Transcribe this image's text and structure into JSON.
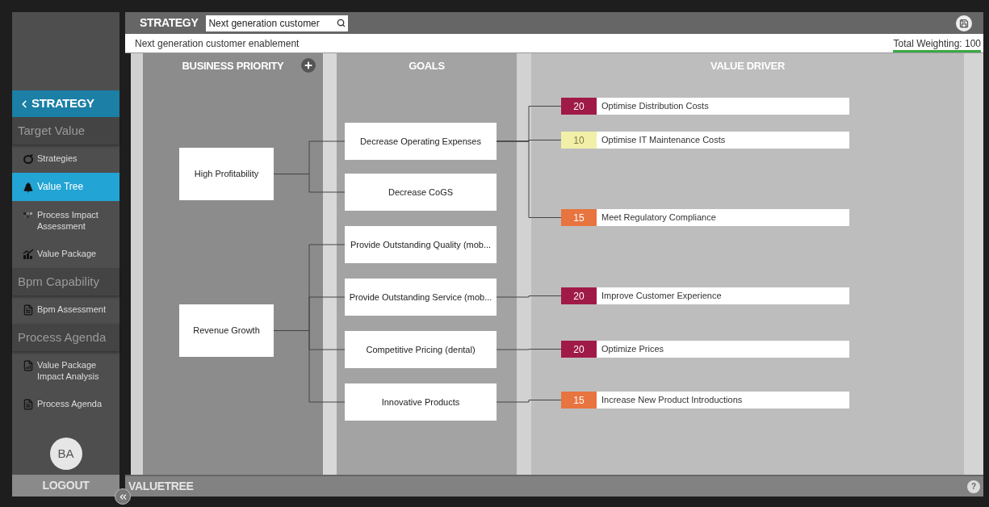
{
  "sidebar": {
    "back": {
      "label": "STRATEGY"
    },
    "items": [
      {
        "kind": "section",
        "label": "Target Value",
        "selected": false
      },
      {
        "kind": "item",
        "label": "Strategies",
        "selected": false
      },
      {
        "kind": "item",
        "label": "Value Tree",
        "selected": true
      },
      {
        "kind": "item",
        "label": "Process Impact Assessment",
        "selected": false
      },
      {
        "kind": "item",
        "label": "Value Package",
        "selected": false
      },
      {
        "kind": "section",
        "label": "Bpm Capability",
        "selected": false
      },
      {
        "kind": "item",
        "label": "Bpm Assessment",
        "selected": false
      },
      {
        "kind": "section",
        "label": "Process Agenda",
        "selected": false
      },
      {
        "kind": "item",
        "label": "Value Package Impact Analysis",
        "selected": false
      },
      {
        "kind": "item",
        "label": "Process Agenda",
        "selected": false
      }
    ],
    "avatar": "BA",
    "logout": "LOGOUT"
  },
  "top_bar": {
    "title": "STRATEGY",
    "search": {
      "value": "Next generation customer"
    }
  },
  "strategy_bar": {
    "name": "Next generation customer enablement",
    "total_weighting": "Total Weighting: 100"
  },
  "columns": [
    "BUSINESS PRIORITY",
    "GOALS",
    "VALUE DRIVER"
  ],
  "business_priorities": [
    {
      "label": "High Profitability",
      "goals": [
        {
          "label": "Decrease Operating Expenses",
          "value_drivers": [
            {
              "weight": "20",
              "label": "Optimise Distribution Costs",
              "color": "#a01a48"
            },
            {
              "weight": "10",
              "label": "Optimise IT Maintenance Costs",
              "color": "#f2f0a8"
            },
            {
              "weight": "15",
              "label": "Meet Regulatory Compliance",
              "color": "#e8743f"
            }
          ]
        },
        {
          "label": "Decrease CoGS"
        }
      ]
    },
    {
      "label": "Revenue Growth",
      "goals": [
        {
          "label": "Provide Outstanding Quality (mob..."
        },
        {
          "label": "Provide Outstanding Service (mob...",
          "value_drivers": [
            {
              "weight": "20",
              "label": "Improve Customer Experience",
              "color": "#a01a48"
            }
          ]
        },
        {
          "label": "Competitive Pricing (dental)",
          "value_drivers": [
            {
              "weight": "20",
              "label": "Optimize Prices",
              "color": "#a01a48"
            }
          ]
        },
        {
          "label": "Innovative Products",
          "value_drivers": [
            {
              "weight": "15",
              "label": "Increase New Product Introductions",
              "color": "#e8743f"
            }
          ]
        }
      ]
    }
  ],
  "bottom_bar": {
    "title": "VALUETREE",
    "help": "?"
  }
}
